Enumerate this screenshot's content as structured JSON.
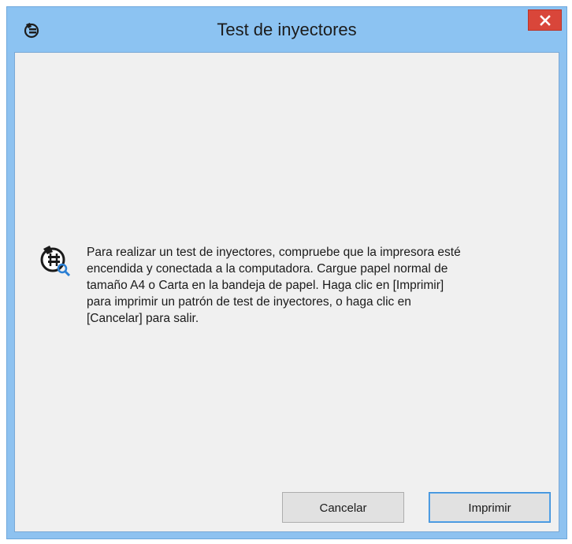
{
  "window": {
    "title": "Test de inyectores",
    "app_icon": "printer-head-icon",
    "close_icon": "close-icon",
    "titlebar_color": "#8cc3f2",
    "close_color": "#d9463a"
  },
  "dialog": {
    "icon": "nozzle-check-icon",
    "message": "Para realizar un test de inyectores, compruebe que la impresora esté\nencendida y conectada a la computadora. Cargue papel normal de\ntamaño A4 o Carta en la bandeja de papel. Haga clic en [Imprimir]\npara imprimir un patrón de test de inyectores, o haga clic en\n[Cancelar] para salir.",
    "buttons": {
      "cancel_label": "Cancelar",
      "print_label": "Imprimir"
    }
  }
}
